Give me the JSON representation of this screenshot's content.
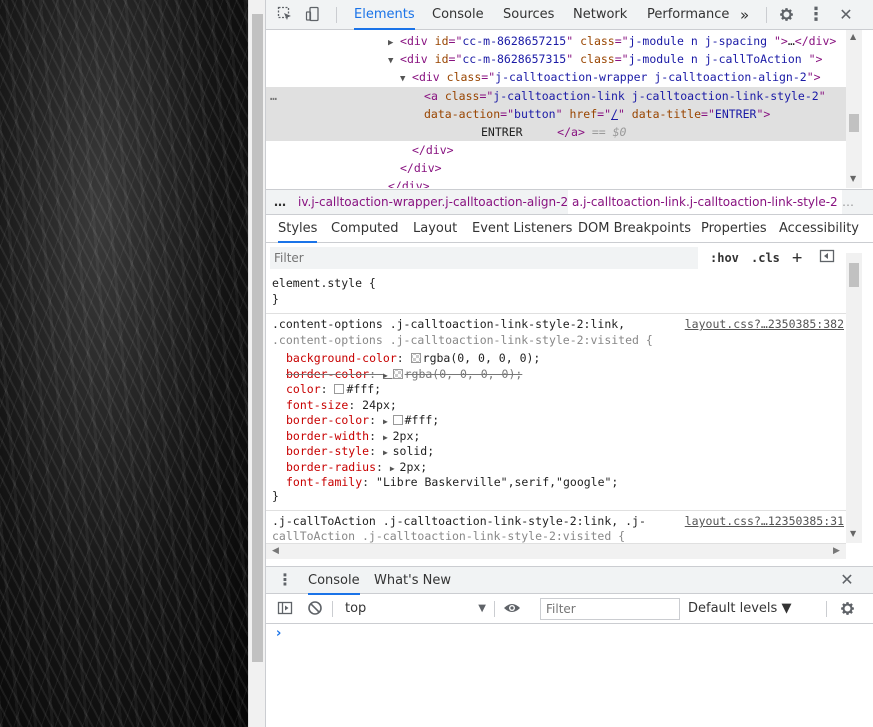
{
  "devtools": {
    "main_tabs": [
      "Elements",
      "Console",
      "Sources",
      "Network",
      "Performance"
    ],
    "more_tabs": "»",
    "close": "✕",
    "kebab": "⋮"
  },
  "tree": {
    "row1": {
      "tag": "div",
      "id_attr": "id",
      "id_val": "cc-m-8628657215",
      "class_attr": "class",
      "class_val": "j-module n j-spacing ",
      "ellipsis": "…",
      "close": "</div>"
    },
    "row2": {
      "tag": "div",
      "id_attr": "id",
      "id_val": "cc-m-8628657315",
      "class_attr": "class",
      "class_val": "j-module n j-callToAction "
    },
    "row3": {
      "tag": "div",
      "class_attr": "class",
      "class_val": "j-calltoaction-wrapper j-calltoaction-align-2"
    },
    "row4": {
      "tag": "a",
      "class_attr": "class",
      "class_val": "j-calltoaction-link j-calltoaction-link-style-2"
    },
    "row5": {
      "a1": "data-action",
      "v1": "button",
      "a2": "href",
      "v2": "/",
      "a3": "data-title",
      "v3": "ENTRER"
    },
    "row6": {
      "text": "ENTRER",
      "close": "</a>",
      "eq": "== $0"
    },
    "row7": "</div>",
    "row8": "</div>",
    "row9": "</div>",
    "ellipsis_dots": "…"
  },
  "breadcrumbs": {
    "dots": "…",
    "item1": "iv.j-calltoaction-wrapper.j-calltoaction-align-2",
    "item2": "a.j-calltoaction-link.j-calltoaction-link-style-2",
    "more": "…"
  },
  "styles_tabs": [
    "Styles",
    "Computed",
    "Layout",
    "Event Listeners",
    "DOM Breakpoints",
    "Properties",
    "Accessibility"
  ],
  "filter": {
    "placeholder": "Filter",
    "hov": ":hov",
    "cls": ".cls",
    "plus": "+"
  },
  "styles": {
    "element_style": "element.style {",
    "close_brace": "}",
    "rule1": {
      "selector_line1": ".content-options .j-calltoaction-link-style-2:link,",
      "selector_line2": ".content-options .j-calltoaction-link-style-2:visited {",
      "source": "layout.css?…2350385:382",
      "props": [
        {
          "name": "background-color",
          "value": "rgba(0, 0, 0, 0);",
          "swatch": "checker",
          "arrow": false,
          "struck": false
        },
        {
          "name": "border-color",
          "value": "rgba(0, 0, 0, 0);",
          "swatch": "checker",
          "arrow": true,
          "struck": true
        },
        {
          "name": "color",
          "value": "#fff;",
          "swatch": "white",
          "arrow": false,
          "struck": false
        },
        {
          "name": "font-size",
          "value": "24px;",
          "swatch": "",
          "arrow": false,
          "struck": false
        },
        {
          "name": "border-color",
          "value": "#fff;",
          "swatch": "white",
          "arrow": true,
          "struck": false
        },
        {
          "name": "border-width",
          "value": "2px;",
          "swatch": "",
          "arrow": true,
          "struck": false
        },
        {
          "name": "border-style",
          "value": "solid;",
          "swatch": "",
          "arrow": true,
          "struck": false
        },
        {
          "name": "border-radius",
          "value": "2px;",
          "swatch": "",
          "arrow": true,
          "struck": false
        },
        {
          "name": "font-family",
          "value": "\"Libre Baskerville\",serif,\"google\";",
          "swatch": "",
          "arrow": false,
          "struck": false
        }
      ]
    },
    "rule2": {
      "selector_line1": ".j-callToAction .j-calltoaction-link-style-2:link, .j-",
      "selector_line2": "callToAction .j-calltoaction-link-style-2:visited {",
      "source": "layout.css?…12350385:31"
    }
  },
  "drawer": {
    "tabs": [
      "Console",
      "What's New"
    ],
    "context": "top",
    "filter_placeholder": "Filter",
    "levels": "Default levels ▼",
    "prompt": "›"
  }
}
